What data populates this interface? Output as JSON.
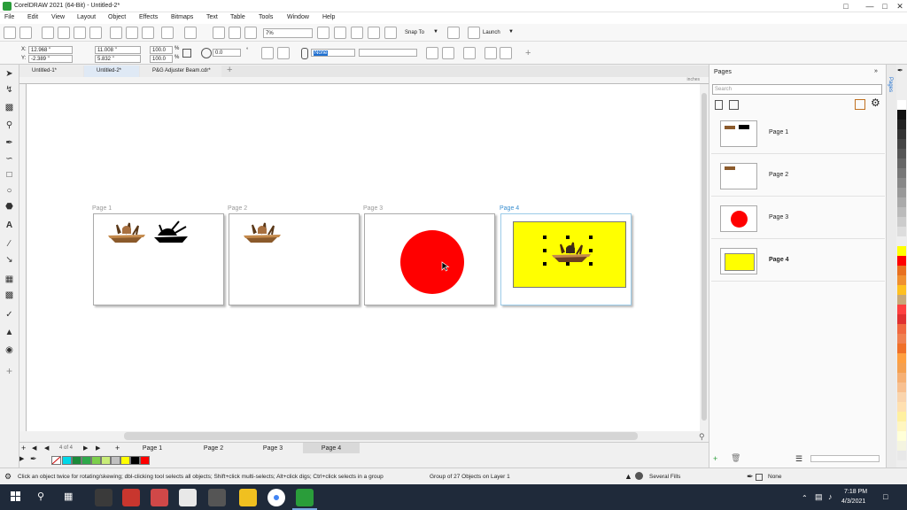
{
  "window": {
    "title": "CorelDRAW 2021 (64-Bit) - Untitled-2*"
  },
  "menu": [
    "File",
    "Edit",
    "View",
    "Layout",
    "Object",
    "Effects",
    "Bitmaps",
    "Text",
    "Table",
    "Tools",
    "Window",
    "Help"
  ],
  "toolbar": {
    "zoom": "7%",
    "snap_to": "Snap To",
    "launch": "Launch"
  },
  "property_bar": {
    "x_label": "X:",
    "x": "12.968 \"",
    "y_label": "Y:",
    "y": "-2.389 \"",
    "width": "11.008 \"",
    "height": "5.832 \"",
    "scale_w": "100.0",
    "scale_h": "100.0",
    "pct1": "%",
    "pct2": "%",
    "rotation": "0.0",
    "rotation_unit": "°",
    "outline_width": "None"
  },
  "doc_tabs": [
    {
      "label": "Untitled-1*",
      "active": false
    },
    {
      "label": "Untitled-2*",
      "active": true
    },
    {
      "label": "P&G Adjuster Beam.cdr*",
      "active": false
    }
  ],
  "ruler_unit": "inches",
  "canvas_pages": [
    {
      "label": "Page 1"
    },
    {
      "label": "Page 2"
    },
    {
      "label": "Page 3"
    },
    {
      "label": "Page 4"
    }
  ],
  "page_nav": {
    "counter": "4 of 4",
    "tabs": [
      "Page 1",
      "Page 2",
      "Page 3",
      "Page 4"
    ],
    "active_tab": "Page 4"
  },
  "document_palette": [
    "#00d8e8",
    "#1b8a3a",
    "#2ea84a",
    "#7ccf4c",
    "#c8ec78",
    "#c0c0c0",
    "#ffff00",
    "#000000",
    "#ff0000"
  ],
  "status": {
    "hint": "Click an object twice for rotating/skewing; dbl-clicking tool selects all objects; Shift+click multi-selects; Alt+click digs; Ctrl+click selects in a group",
    "selection": "Group of 27 Objects on Layer 1",
    "fill": "Several Fills",
    "outline": "None"
  },
  "pages_panel": {
    "header": "Pages",
    "search_placeholder": "Search",
    "side_tab": "Pages",
    "items": [
      {
        "label": "Page 1",
        "bold": false
      },
      {
        "label": "Page 2",
        "bold": false
      },
      {
        "label": "Page 3",
        "bold": false
      },
      {
        "label": "Page 4",
        "bold": true
      }
    ]
  },
  "color_palette": [
    "#ffffff",
    "#111111",
    "#222222",
    "#333333",
    "#444444",
    "#555555",
    "#666666",
    "#777777",
    "#888888",
    "#999999",
    "#aaaaaa",
    "#bbbbbb",
    "#cccccc",
    "#dddddd",
    "#eeeeee",
    "#ffff00",
    "#ff0000",
    "#e87020",
    "#f09030",
    "#ffc020",
    "#c8a878",
    "#ff4040",
    "#e03030",
    "#f06840",
    "#f08050",
    "#f07028",
    "#ff9f40",
    "#f5a050",
    "#f6b074",
    "#f8c090",
    "#fad4ac",
    "#ffe0b0",
    "#fff0a0",
    "#fff6c0",
    "#ffffd8",
    "#f4f4e0",
    "#e8e8e8"
  ],
  "taskbar": {
    "time": "7:18 PM",
    "date": "4/3/2021"
  }
}
